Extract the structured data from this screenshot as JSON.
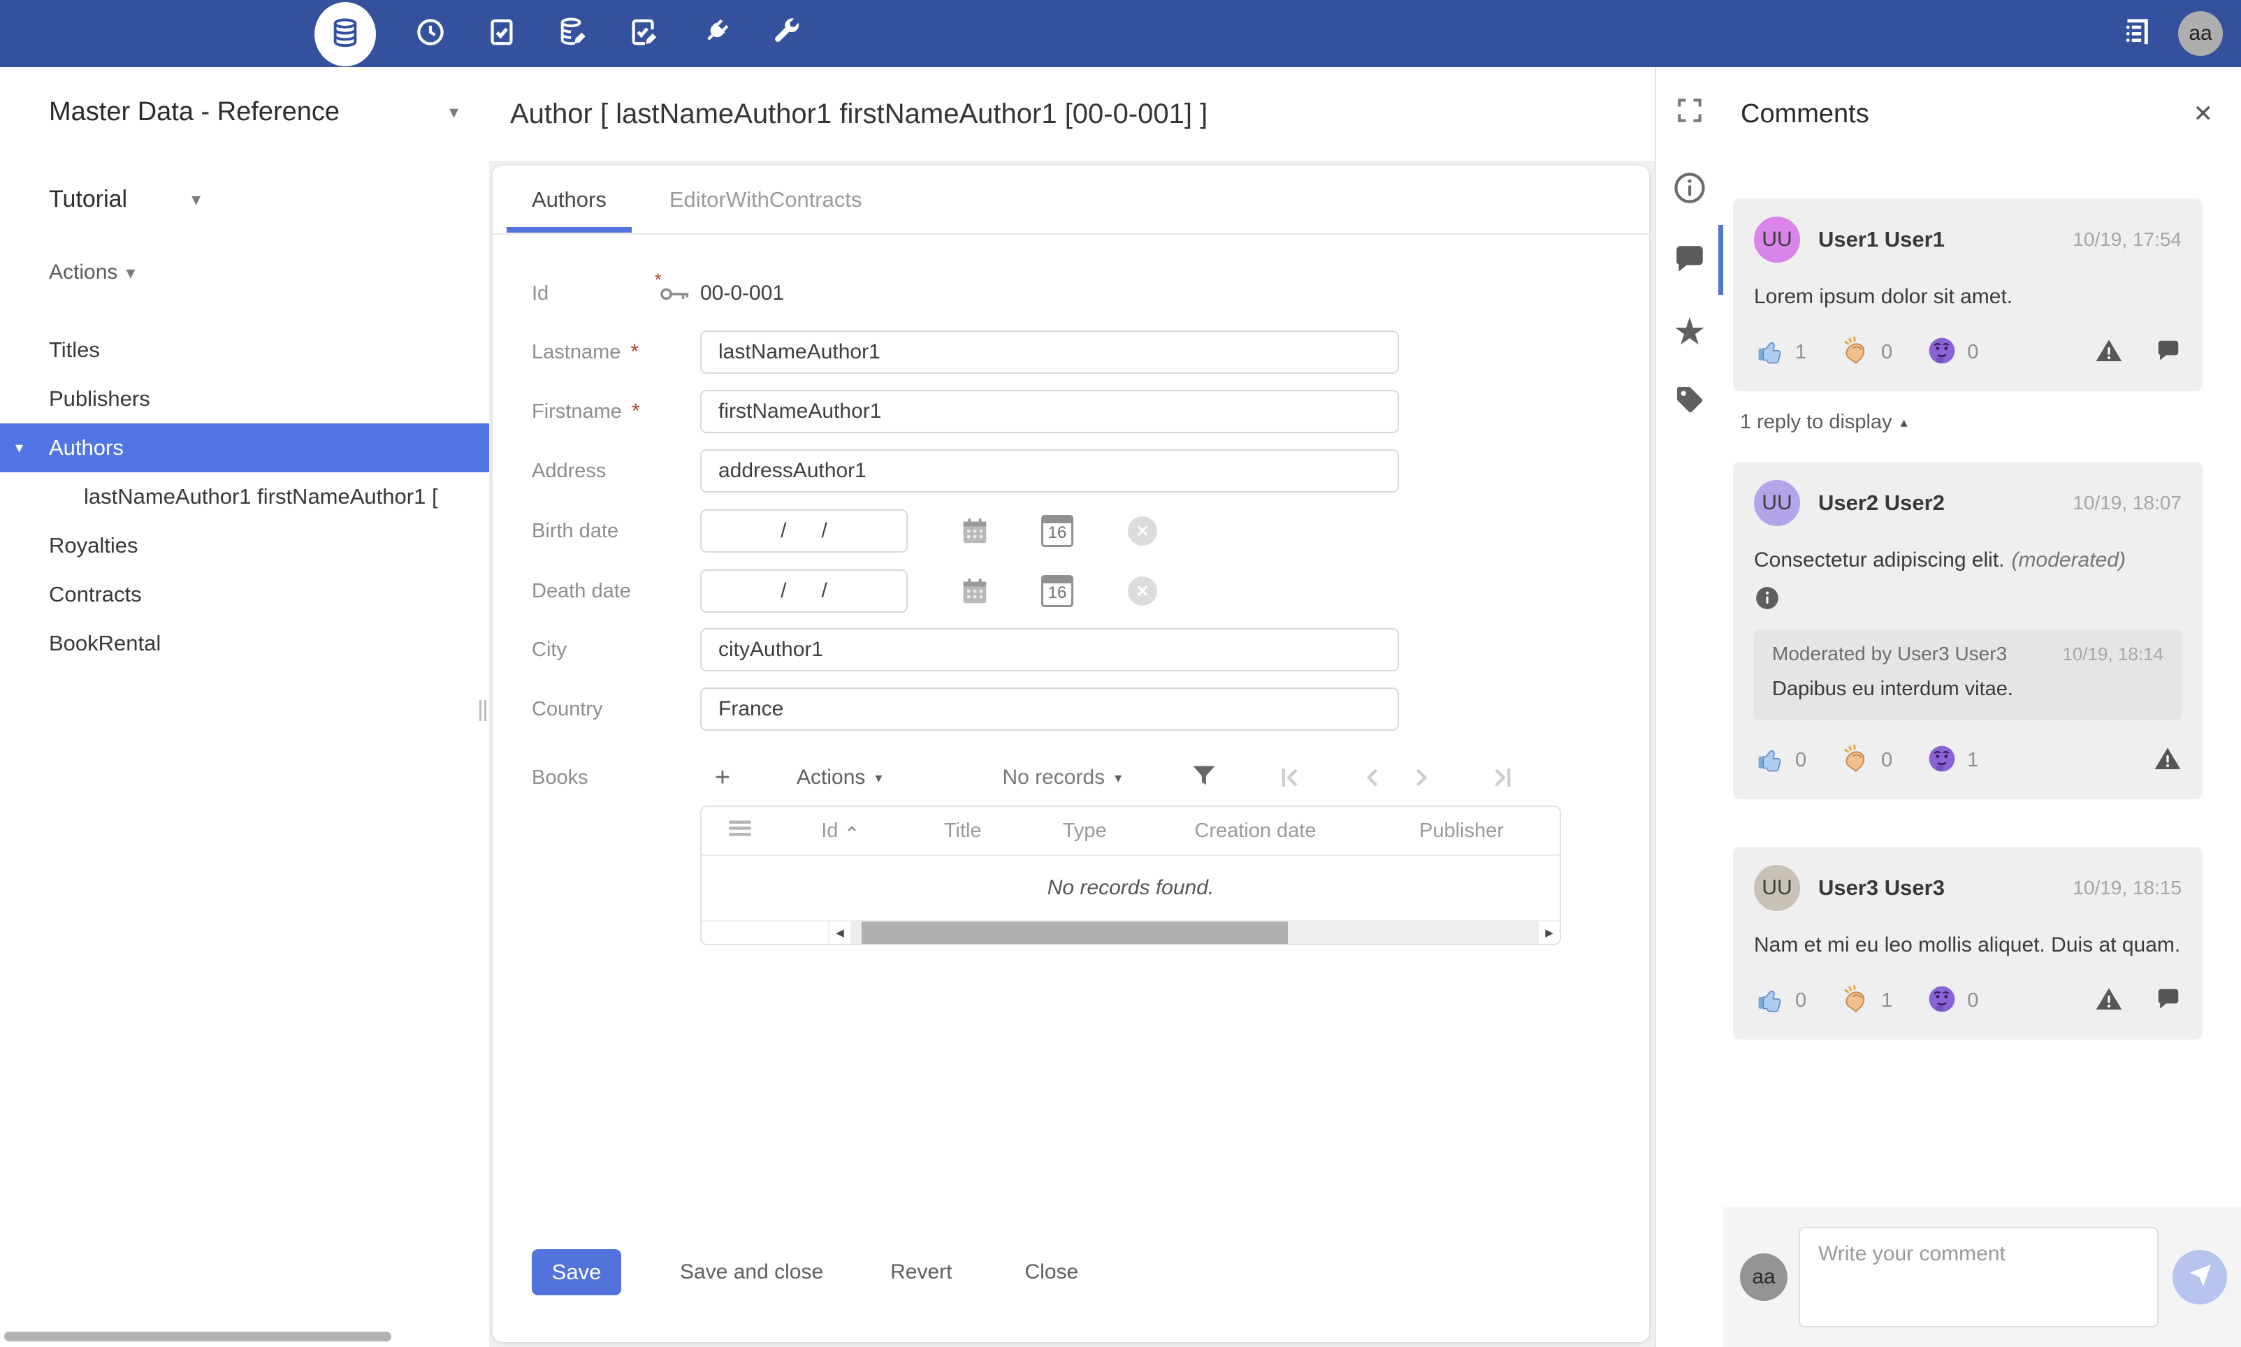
{
  "colors": {
    "topbar": "#34519e",
    "accent": "#5273dc",
    "selection": "#5176e3"
  },
  "icons": {
    "caret_down": "▾",
    "collapse_up": "▴",
    "close": "✕",
    "plus": "+",
    "left_arrow": "◀",
    "right_arrow": "▶",
    "star": "★"
  },
  "topbar": {
    "avatar": "aa"
  },
  "sidebar": {
    "app_title": "Master Data - Reference",
    "section_title": "Tutorial",
    "actions_label": "Actions",
    "items": {
      "titles": "Titles",
      "publishers": "Publishers",
      "authors": "Authors",
      "author_record": "lastNameAuthor1 firstNameAuthor1 [",
      "royalties": "Royalties",
      "contracts": "Contracts",
      "bookrental": "BookRental"
    }
  },
  "main": {
    "title": "Author [ lastNameAuthor1 firstNameAuthor1 [00-0-001] ]",
    "tabs": {
      "authors": "Authors",
      "editor": "EditorWithContracts"
    },
    "form": {
      "id_label": "Id",
      "id_value": "00-0-001",
      "required_marker": "*",
      "lastname_label": "Lastname",
      "lastname_value": "lastNameAuthor1",
      "firstname_label": "Firstname",
      "firstname_value": "firstNameAuthor1",
      "address_label": "Address",
      "address_value": "addressAuthor1",
      "birth_label": "Birth date",
      "death_label": "Death date",
      "date_placeholder": "/      /",
      "calendar_day": "16",
      "city_label": "City",
      "city_value": "cityAuthor1",
      "country_label": "Country",
      "country_value": "France"
    },
    "books": {
      "label": "Books",
      "actions_label": "Actions",
      "pager_label": "No records",
      "columns": [
        "Id",
        "Title",
        "Type",
        "Creation date",
        "Publisher"
      ],
      "empty_message": "No records found."
    },
    "buttons": {
      "save": "Save",
      "save_and_close": "Save and close",
      "revert": "Revert",
      "close": "Close"
    }
  },
  "comments": {
    "title": "Comments",
    "reply_toggle": "1 reply to display",
    "items": [
      {
        "initials": "UU",
        "avatar_style": "background:#d884e8",
        "name": "User1 User1",
        "time": "10/19, 17:54",
        "text": "Lorem ipsum dolor sit amet.",
        "like": "1",
        "clap": "0",
        "think": "0"
      },
      {
        "initials": "UU",
        "avatar_style": "background:#b3a4ea",
        "name": "User2 User2",
        "time": "10/19, 18:07",
        "text": "Consectetur adipiscing elit.",
        "moderated_note": "(moderated)",
        "moderation_title": "Moderated by User3 User3",
        "moderation_time": "10/19, 18:14",
        "moderation_text": "Dapibus eu interdum vitae.",
        "like": "0",
        "clap": "0",
        "think": "1"
      },
      {
        "initials": "UU",
        "avatar_style": "background:#c8c1b5",
        "name": "User3 User3",
        "time": "10/19, 18:15",
        "text": "Nam et mi eu leo mollis aliquet. Duis at quam.",
        "like": "0",
        "clap": "1",
        "think": "0"
      }
    ],
    "composer": {
      "avatar": "aa",
      "placeholder": "Write your comment"
    }
  }
}
